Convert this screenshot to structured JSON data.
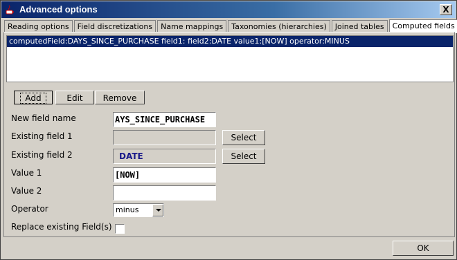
{
  "window": {
    "title": "Advanced options",
    "close_label": "X"
  },
  "tabs": [
    {
      "label": "Reading options"
    },
    {
      "label": "Field discretizations"
    },
    {
      "label": "Name mappings"
    },
    {
      "label": "Taxonomies (hierarchies)"
    },
    {
      "label": "Joined tables"
    },
    {
      "label": "Computed fields",
      "active": true
    }
  ],
  "list": {
    "items": [
      "computedField:DAYS_SINCE_PURCHASE field1: field2:DATE value1:[NOW] operator:MINUS"
    ]
  },
  "actions": {
    "add": "Add",
    "edit": "Edit",
    "remove": "Remove"
  },
  "form": {
    "new_field_name_label": "New field name",
    "new_field_name_value": "AYS_SINCE_PURCHASE",
    "existing_field1_label": "Existing field 1",
    "existing_field1_value": "",
    "existing_field2_label": "Existing field 2",
    "existing_field2_value": "DATE",
    "select_label": "Select",
    "value1_label": "Value 1",
    "value1_value": "[NOW]",
    "value2_label": "Value 2",
    "value2_value": "",
    "operator_label": "Operator",
    "operator_value": "minus",
    "replace_label": "Replace existing Field(s)",
    "replace_checked": false
  },
  "footer": {
    "ok": "OK"
  }
}
